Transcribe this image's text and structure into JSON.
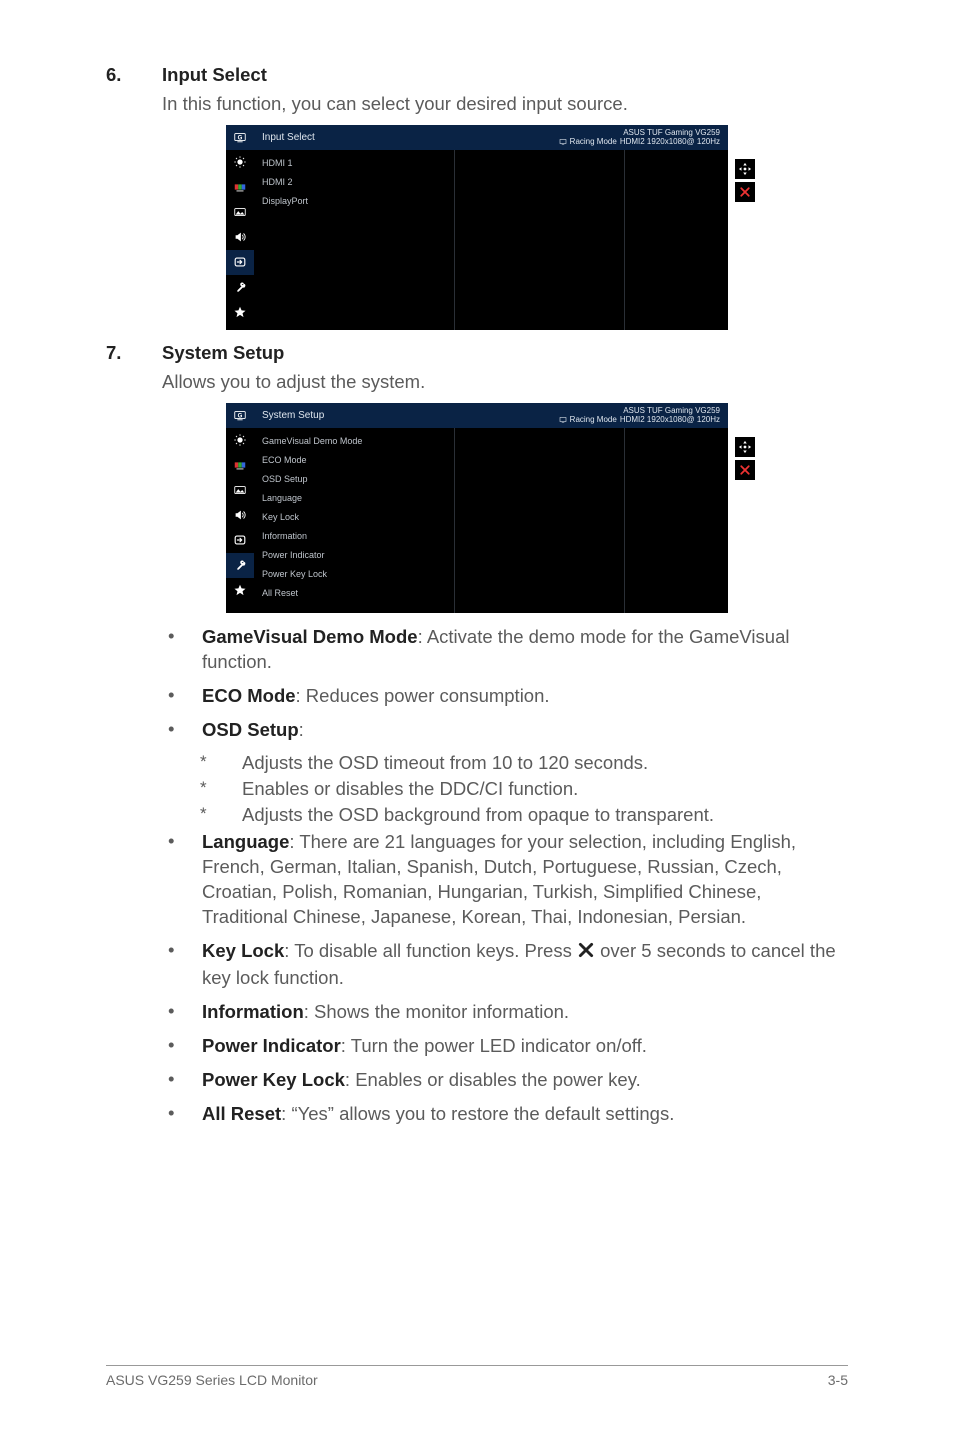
{
  "section6": {
    "number": "6.",
    "title": "Input Select",
    "desc": "In this function, you can select your desired input source."
  },
  "section7": {
    "number": "7.",
    "title": "System Setup",
    "desc": "Allows you to adjust the system."
  },
  "osd1": {
    "title": "Input Select",
    "info1": "ASUS TUF Gaming  VG259",
    "info2_pre": "Racing Mode",
    "info2_post": "HDMI2 1920x1080@ 120Hz",
    "items": [
      "HDMI 1",
      "HDMI 2",
      "DisplayPort"
    ]
  },
  "osd2": {
    "title": "System Setup",
    "info1": "ASUS TUF Gaming  VG259",
    "info2_pre": "Racing Mode",
    "info2_post": "HDMI2 1920x1080@ 120Hz",
    "items": [
      "GameVisual Demo Mode",
      "ECO Mode",
      "OSD Setup",
      "Language",
      "Key Lock",
      "Information",
      "Power Indicator",
      "Power Key Lock",
      "All Reset"
    ]
  },
  "bullets": {
    "gv": {
      "label": "GameVisual Demo Mode",
      "text": ": Activate the demo mode for the GameVisual function."
    },
    "eco": {
      "label": "ECO Mode",
      "text": ": Reduces power consumption."
    },
    "osd": {
      "label": "OSD Setup",
      "text": ":"
    },
    "osd_sub": [
      "Adjusts the OSD timeout from 10 to 120 seconds.",
      "Enables or disables the DDC/CI function.",
      "Adjusts the OSD background from opaque to transparent."
    ],
    "lang": {
      "label": "Language",
      "text": ": There are 21 languages for your selection, including English, French, German, Italian, Spanish, Dutch, Portuguese, Russian, Czech, Croatian, Polish, Romanian, Hungarian, Turkish, Simplified Chinese, Traditional Chinese, Japanese, Korean, Thai, Indonesian, Persian."
    },
    "keylock": {
      "label": "Key Lock",
      "text_pre": ": To disable all function keys. Press ",
      "text_post": " over 5 seconds to cancel the key lock function."
    },
    "info": {
      "label": "Information",
      "text": ": Shows the monitor information."
    },
    "pind": {
      "label": "Power Indicator",
      "text": ": Turn the power LED indicator on/off."
    },
    "pkey": {
      "label": "Power Key Lock",
      "text": ": Enables or disables the power key."
    },
    "areset": {
      "label": "All Reset",
      "text": ": “Yes” allows you to restore the default settings."
    }
  },
  "footer": {
    "left": "ASUS VG259 Series LCD Monitor",
    "right": "3-5"
  },
  "icons": {
    "monitor_sq": "☐"
  }
}
